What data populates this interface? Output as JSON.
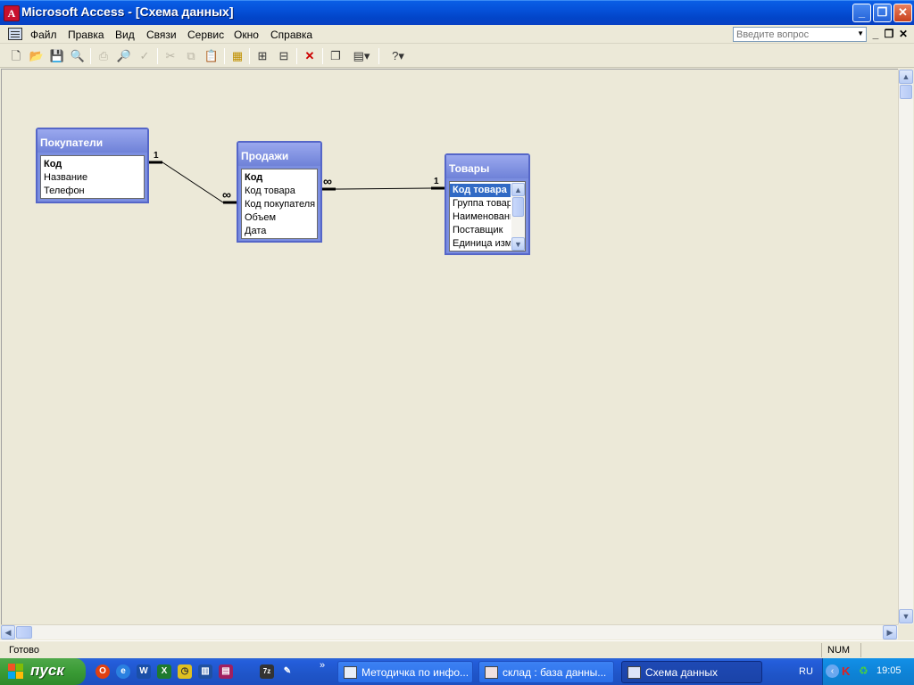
{
  "window": {
    "title": "Microsoft Access - [Схема данных]",
    "app_icon_letter": "A",
    "minimize": "_",
    "restore": "❐",
    "close": "✕"
  },
  "menu": {
    "items": [
      "Файл",
      "Правка",
      "Вид",
      "Связи",
      "Сервис",
      "Окно",
      "Справка"
    ],
    "help_placeholder": "Введите вопрос"
  },
  "toolbar": {
    "icons": [
      "new-icon",
      "open-icon",
      "save-icon",
      "search-icon",
      "print-icon",
      "print-preview-icon",
      "spelling-icon",
      "cut-icon",
      "copy-icon",
      "paste-icon",
      "show-table-icon",
      "show-direct-icon",
      "show-all-icon",
      "delete-icon",
      "new-object-icon",
      "database-window-icon",
      "help-icon"
    ]
  },
  "tables": [
    {
      "name": "Покупатели",
      "fields": [
        "Код",
        "Название",
        "Телефон"
      ],
      "key": "Код"
    },
    {
      "name": "Продажи",
      "fields": [
        "Код",
        "Код товара",
        "Код покупателя",
        "Объем",
        "Дата"
      ],
      "key": "Код"
    },
    {
      "name": "Товары",
      "fields": [
        "Код товара",
        "Группа товар",
        "Наименовани",
        "Поставщик",
        "Единица изме"
      ],
      "key": "Код товара",
      "selected": "Код товара"
    }
  ],
  "relations": [
    {
      "one_label": "1",
      "many_label": "∞"
    },
    {
      "one_label": "1",
      "many_label": "∞"
    }
  ],
  "status": {
    "text": "Готово",
    "num": "NUM"
  },
  "taskbar": {
    "start": "пуск",
    "tasks": [
      "Методичка по инфо...",
      "склад : база данны...",
      "Схема данных"
    ],
    "lang": "RU",
    "clock": "19:05",
    "more": "»"
  },
  "colors": {
    "title_bar": "#0550d8",
    "table_header": "#7b8ee0",
    "selection": "#316ac5",
    "taskbar": "#245edc",
    "start_button": "#3a9b35"
  }
}
